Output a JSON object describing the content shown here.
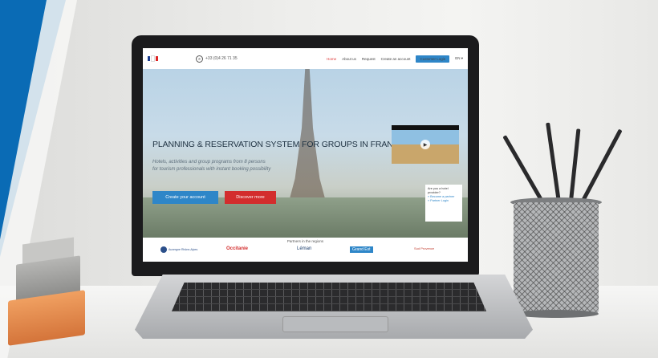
{
  "site": {
    "phone": "+33 (0)4 26 71 35",
    "nav": [
      "Home",
      "About us",
      "Request",
      "Create an account"
    ],
    "login": "Customer Login",
    "lang": "EN ▾",
    "headline": "PLANNING & RESERVATION SYSTEM FOR GROUPS IN FRANCE",
    "sub1": "Hotels, activities and group programs from 8 persons",
    "sub2": "for tourism professionals with instant booking possibility",
    "btn_create": "Create your account",
    "btn_discover": "Discover more",
    "hotel_q": "Are you a hotel provider?",
    "hotel_link1": "» Become a partner",
    "hotel_link2": "» Partner Login",
    "partners_title": "Partners in the regions",
    "partners": [
      "Auvergne Rhône-Alpes",
      "Occitanie",
      "Léman",
      "Grand Est",
      "Sud Provence"
    ]
  },
  "colors": {
    "accent_blue": "#2e86c8",
    "accent_red": "#d32d2d",
    "brand_blue": "#0a6bb5"
  }
}
